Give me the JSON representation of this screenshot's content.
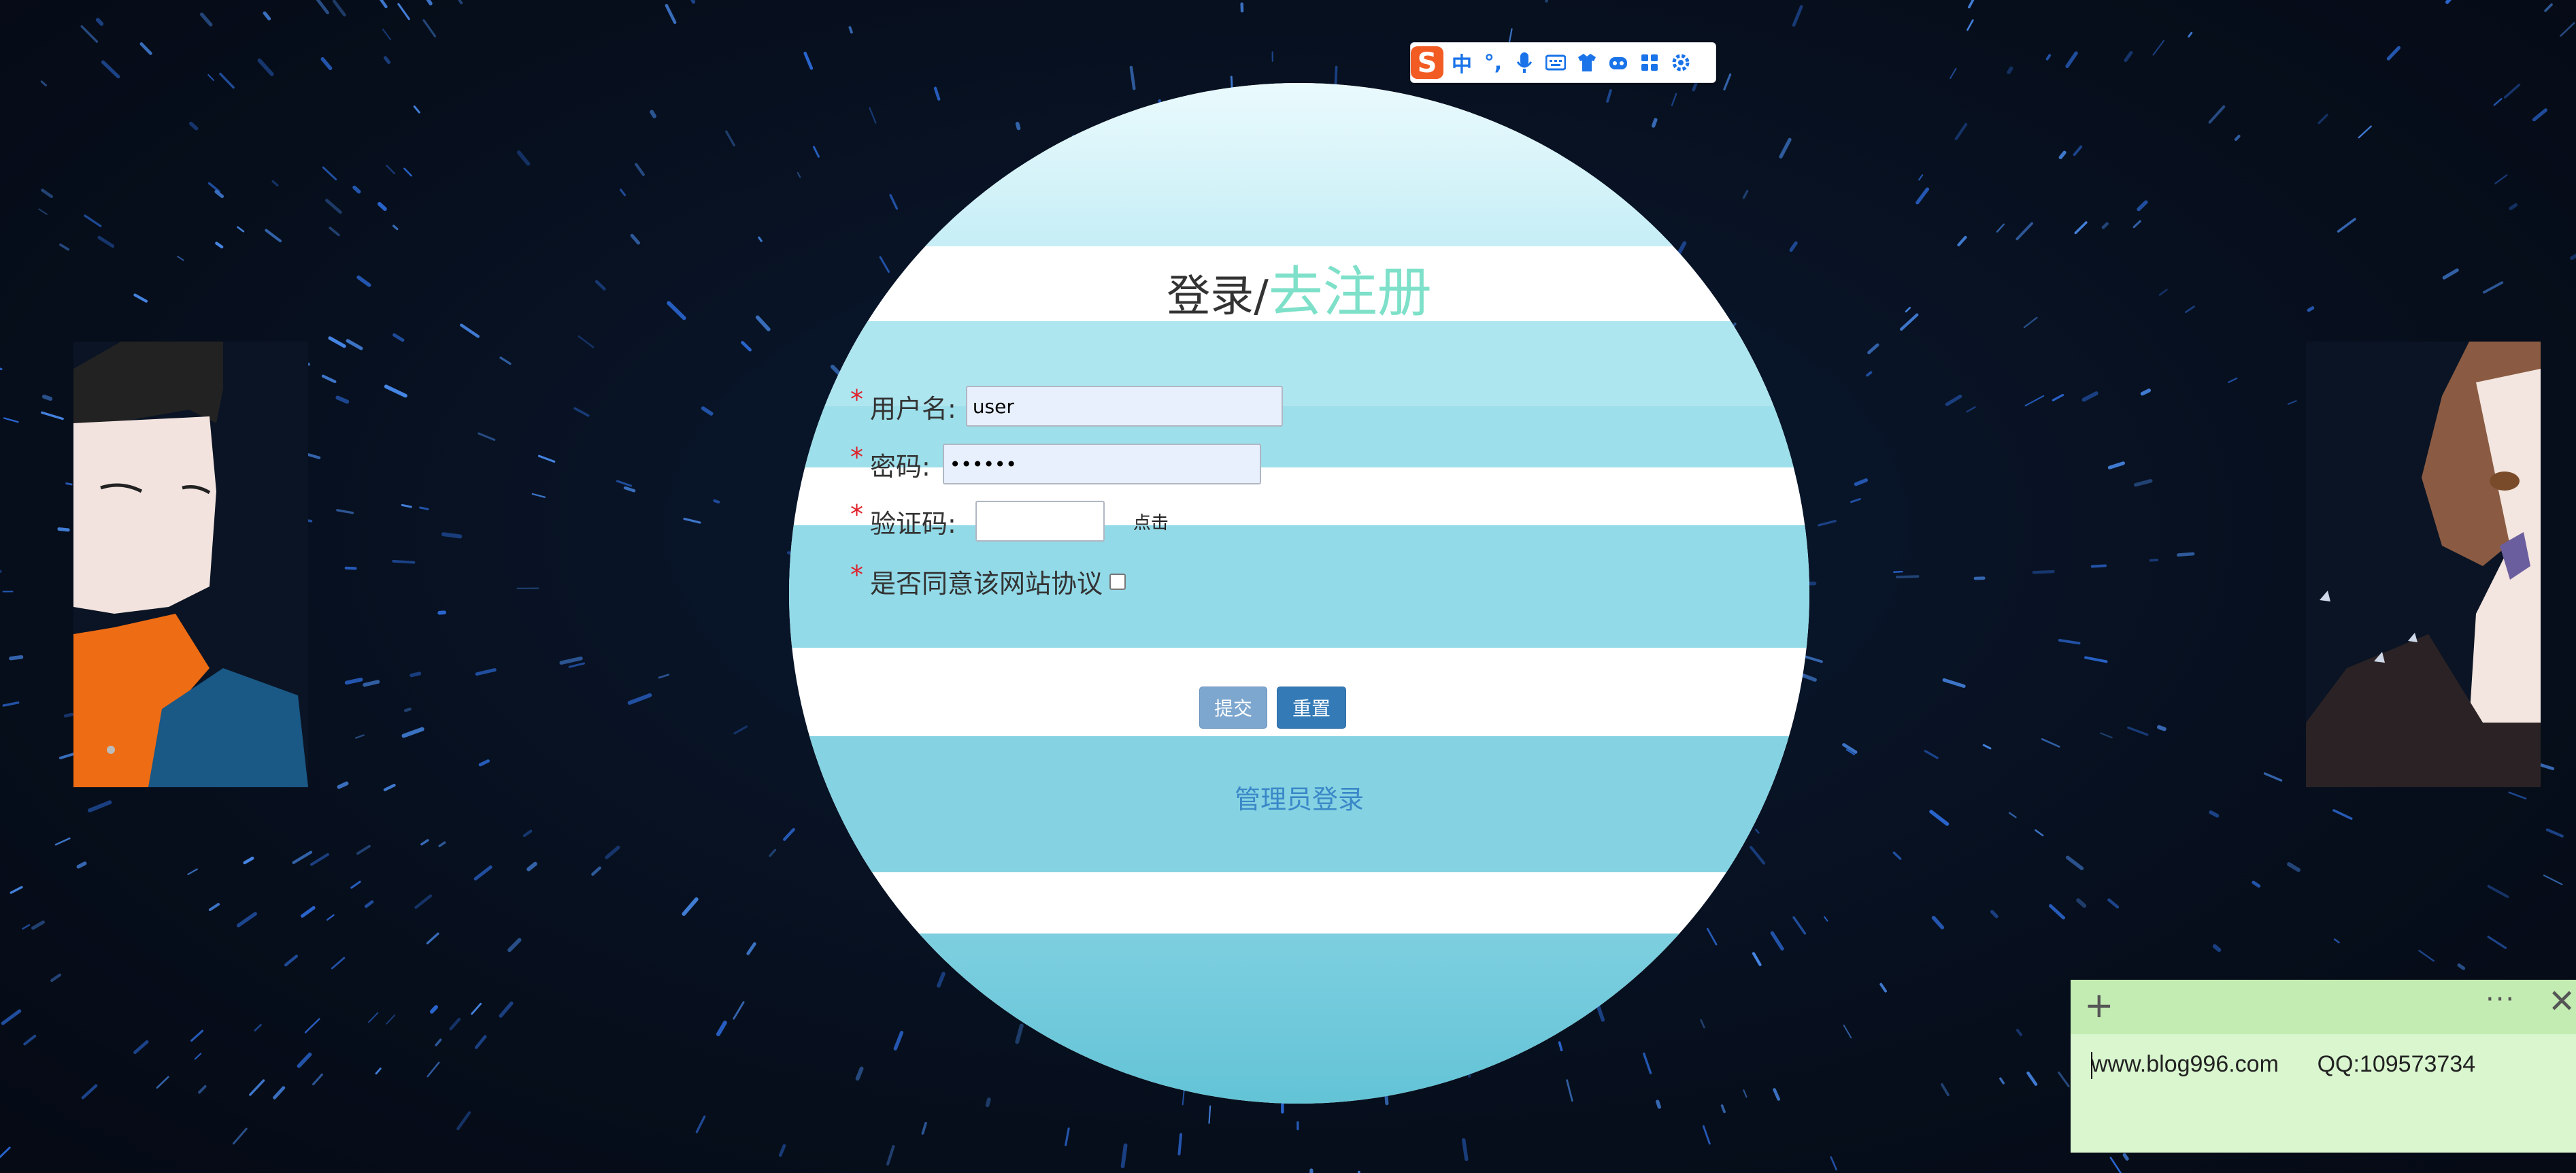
{
  "ime_toolbar": {
    "logo": "S",
    "items": [
      "中",
      "°,",
      "mic-icon",
      "keyboard-icon",
      "skin-icon",
      "robot-icon",
      "apps-icon",
      "settings-icon"
    ]
  },
  "login": {
    "title_login": "登录/",
    "title_register": "去注册",
    "username_label": "用户名:",
    "username_value": "user",
    "password_label": "密码:",
    "password_value": "••••••",
    "captcha_label": "验证码:",
    "captcha_value": "",
    "captcha_button": "点击",
    "agree_label": "是否同意该网站协议",
    "required_mark": "*",
    "submit": "提交",
    "reset": "重置",
    "admin_link": "管理员登录"
  },
  "note": {
    "text": "www.blog996.com      QQ:109573734",
    "add_icon": "+",
    "more_icon": "···",
    "close_icon": "✕"
  },
  "colors": {
    "background": "#07101f",
    "accent_register": "#7ee0c9",
    "stripe_blue": "#8fd8e4",
    "required_red": "#e0202a",
    "primary_button": "#337ab7",
    "note_bg": "#d9f6cf"
  }
}
